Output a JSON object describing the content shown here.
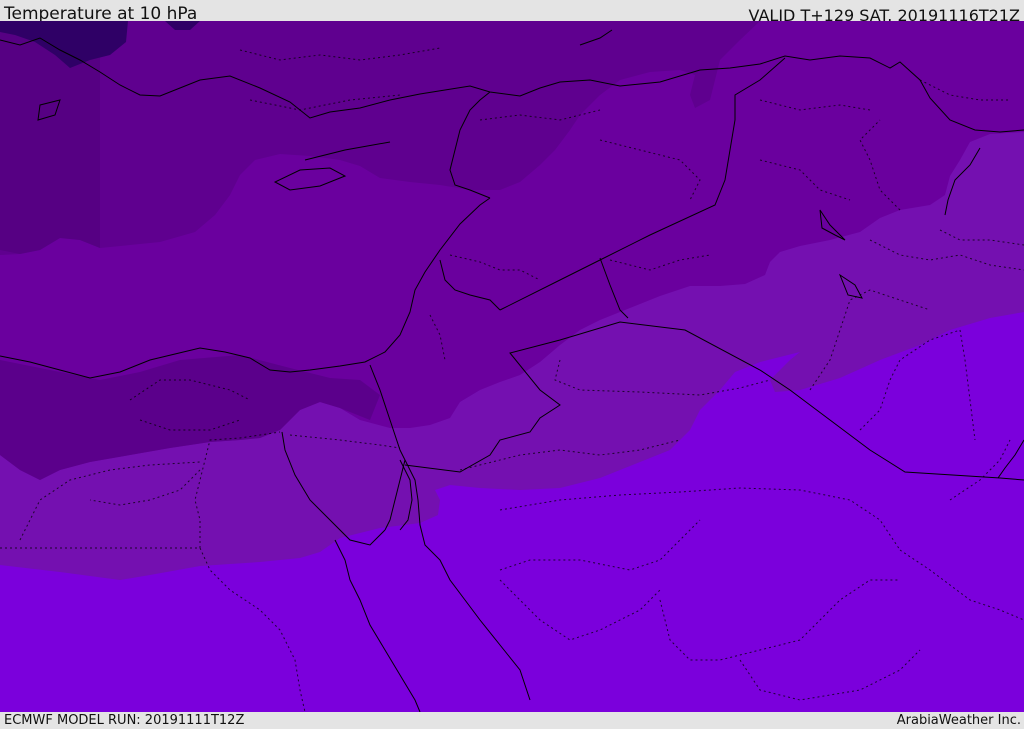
{
  "header": {
    "title": "Temperature at 10 hPa",
    "valid": "VALID T+129 SAT. 20191116T21Z"
  },
  "footer": {
    "model_run": "ECMWF MODEL RUN: 20191111T12Z",
    "credit": "ArabiaWeather Inc."
  },
  "colors": {
    "band_1": "#2f0066",
    "band_2": "#4f007a",
    "band_3": "#5f008f",
    "band_4": "#6a009e",
    "band_5": "#7410b0",
    "band_6": "#7b00dc",
    "border": "#000000"
  }
}
